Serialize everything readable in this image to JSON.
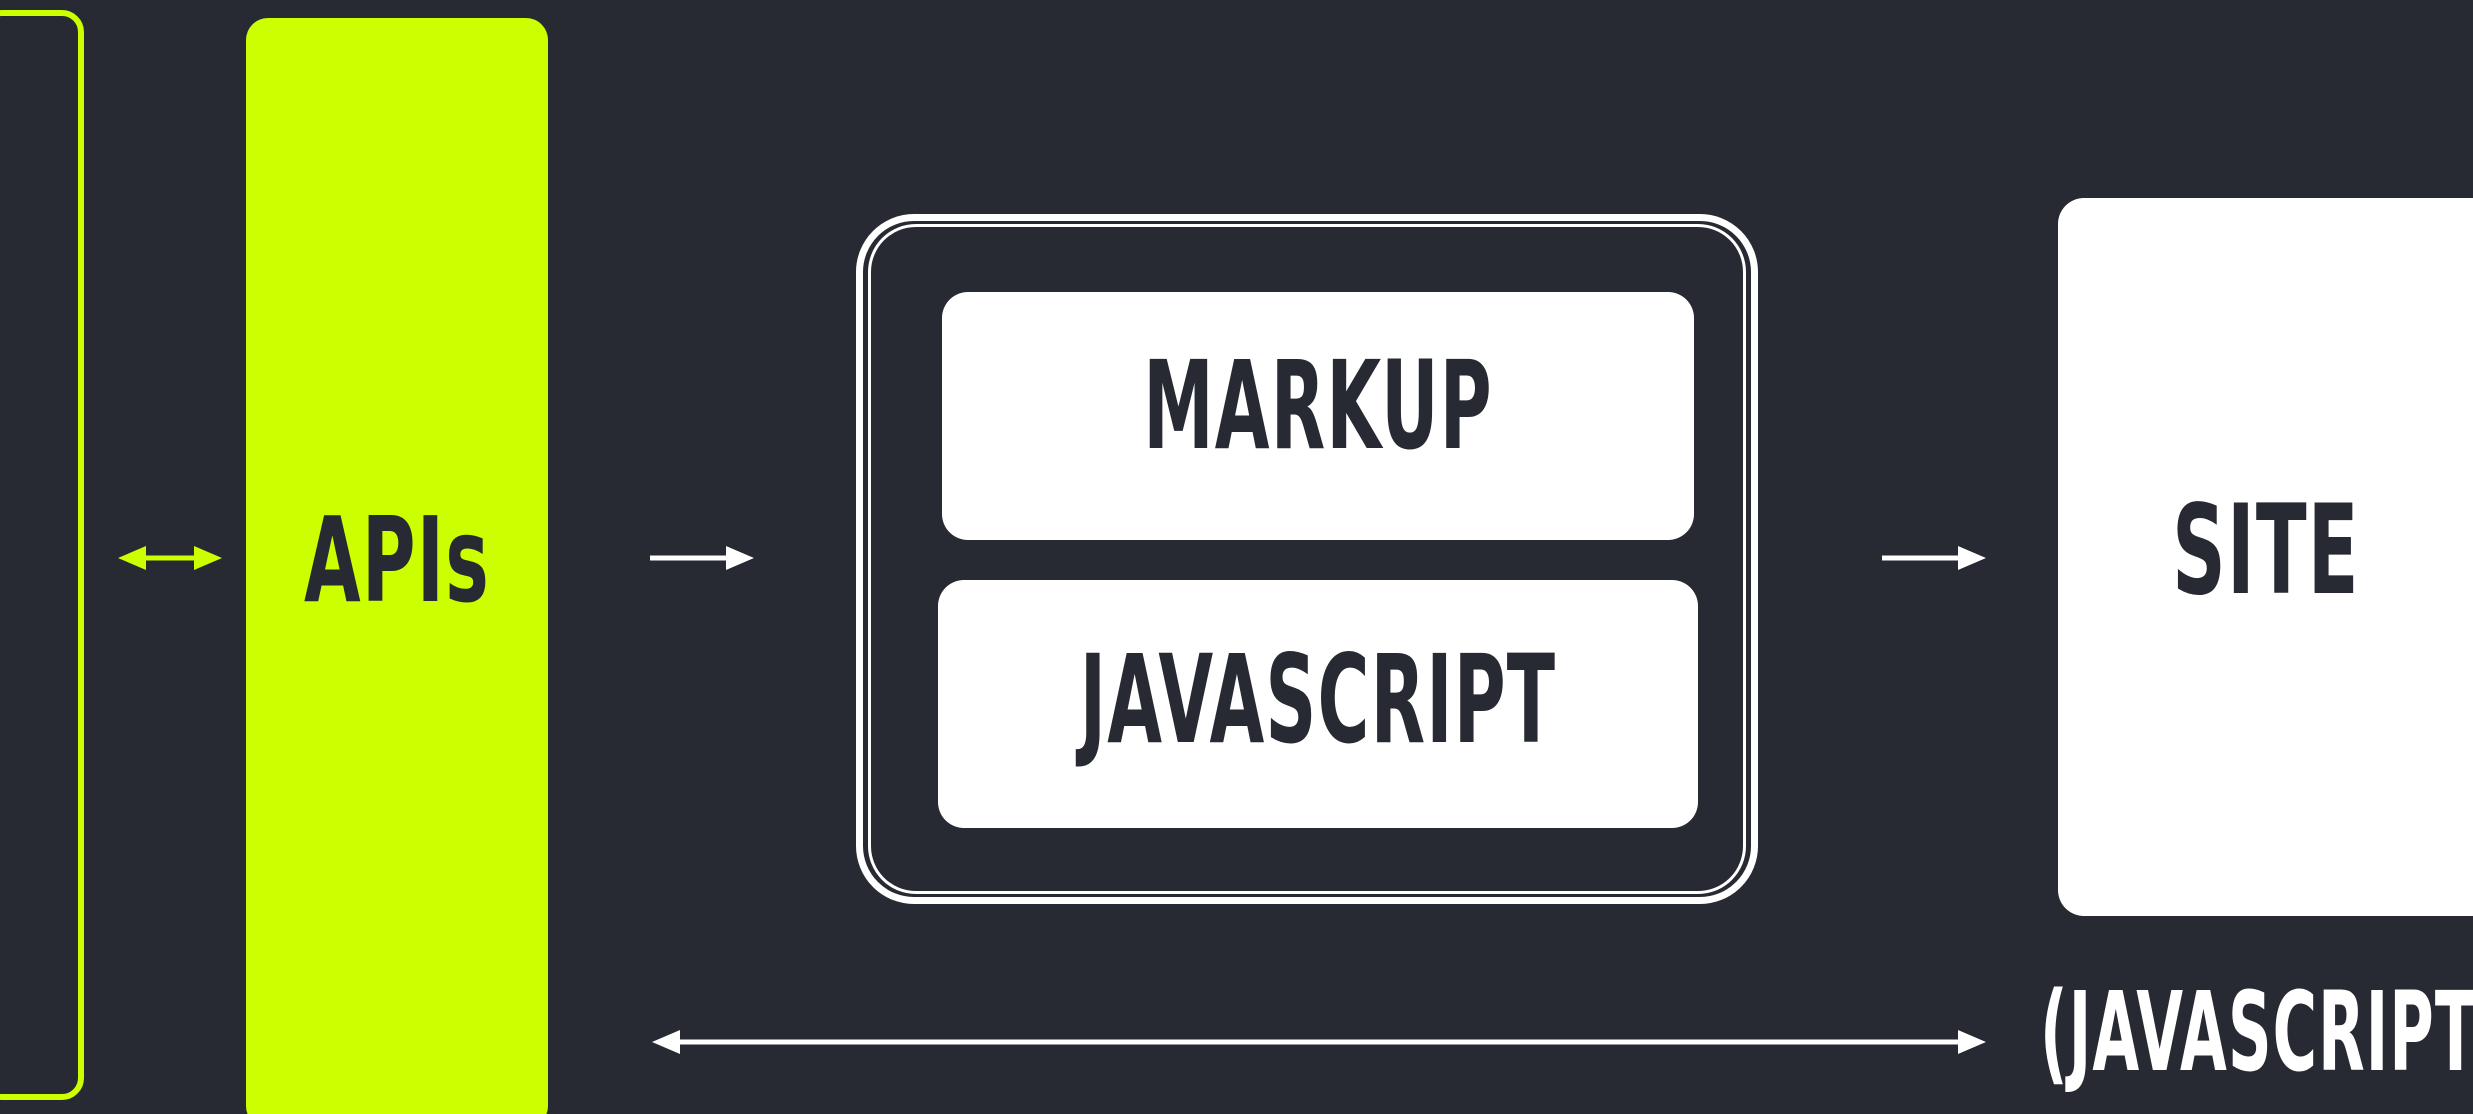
{
  "diagram": {
    "apis_label": "APIs",
    "markup_label": "MARKUP",
    "javascript_label": "JAVASCRIPT",
    "site_label": "SITE",
    "bottom_label": "(JAVASCRIPT)"
  },
  "colors": {
    "background": "#272a32",
    "accent": "#ccff00",
    "white": "#ffffff",
    "text_dark": "#272a32"
  },
  "icons": {
    "arrow_bidirectional": "double-arrow-icon",
    "arrow_right": "arrow-right-icon"
  }
}
